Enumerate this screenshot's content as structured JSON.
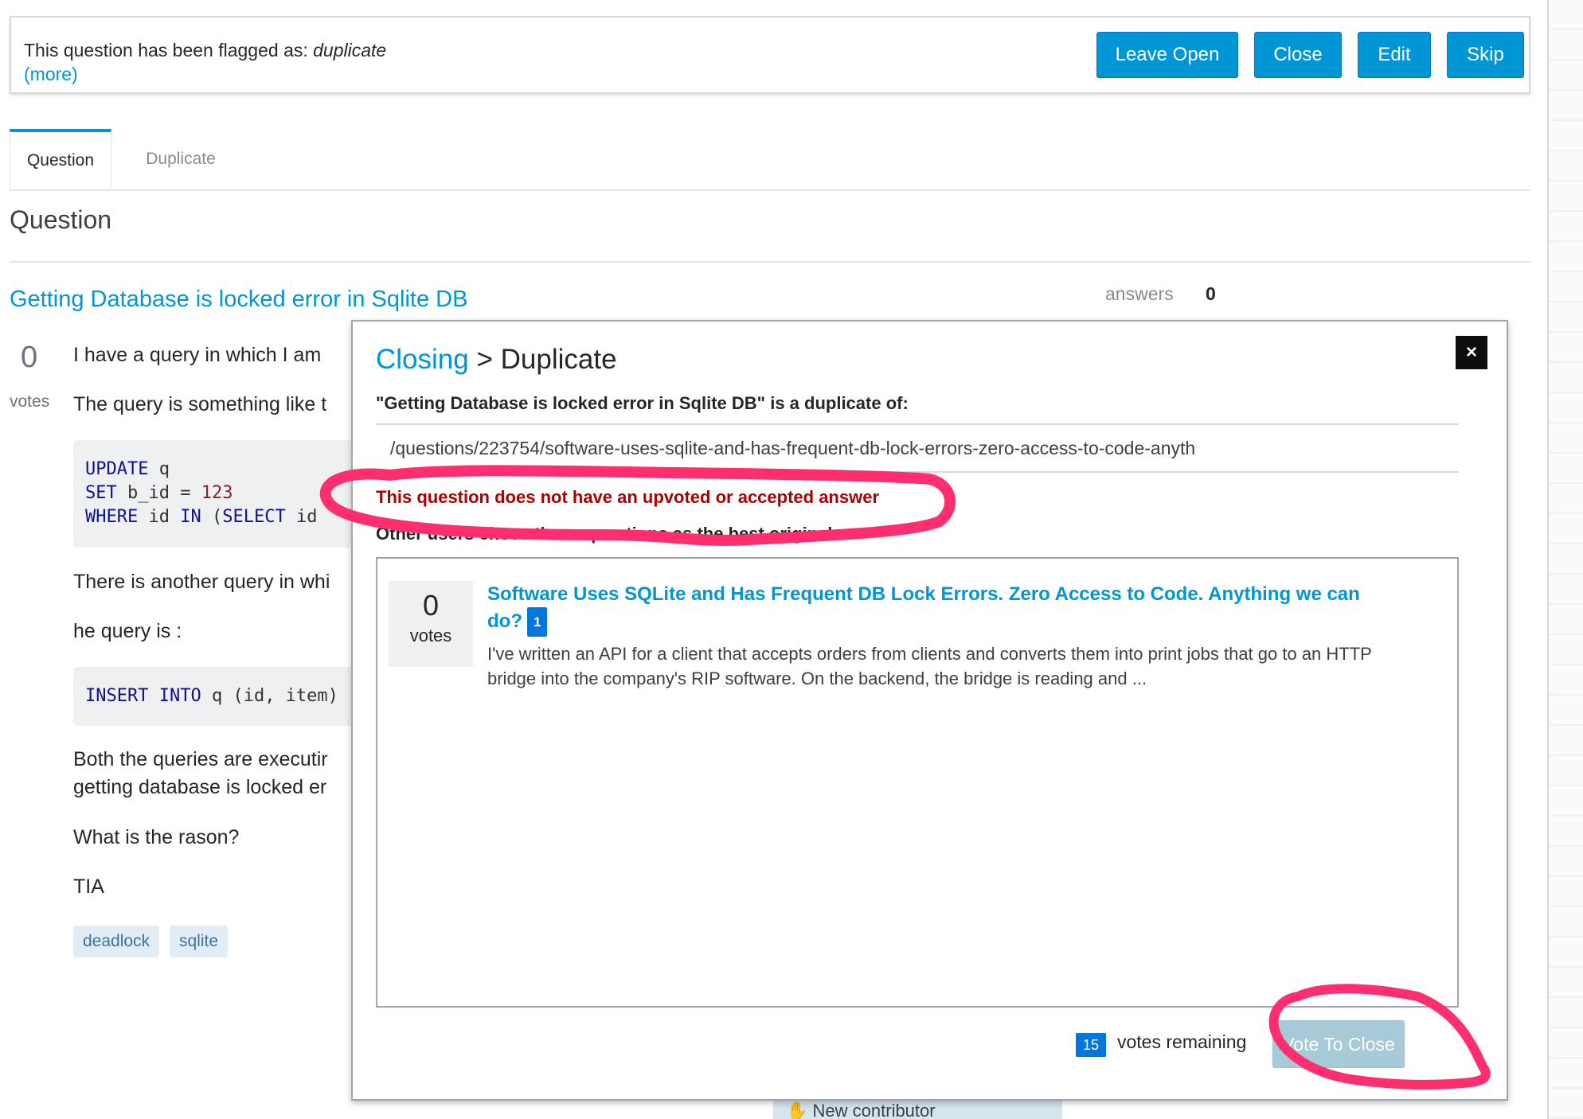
{
  "banner": {
    "flag_text": "This question has been flagged as:",
    "flag_reason": "duplicate",
    "more_link": "(more)",
    "buttons": [
      "Leave Open",
      "Close",
      "Edit",
      "Skip"
    ]
  },
  "tabs": [
    {
      "label": "Question",
      "active": true
    },
    {
      "label": "Duplicate",
      "active": false
    }
  ],
  "section_title": "Question",
  "question": {
    "title": "Getting Database is locked error in Sqlite DB",
    "answers_label": "answers",
    "answers_count": "0",
    "votes": "0",
    "votes_label": "votes",
    "paragraphs": [
      "I have a query in which I am",
      "The query is something like t",
      "There is another query in whi",
      "he query is :",
      "Both the queries are executir",
      "getting database is locked er",
      "What is the rason?",
      "TIA"
    ],
    "code1": {
      "line1_kw": "UPDATE",
      "line1_rest": " q",
      "line2_kw": "SET",
      "line2_rest": " b_id = ",
      "line2_num": "123",
      "line3_kw": "WHERE",
      "line3_mid": " id ",
      "line3_kw2": "IN",
      "line3_rest": " (",
      "line3_kw3": "SELECT",
      "line3_end": " id "
    },
    "code2": {
      "kw1": "INSERT",
      "kw2": "INTO",
      "rest": " q (id, item)"
    },
    "tags": [
      "deadlock",
      "sqlite"
    ],
    "new_contributor": "New contributor"
  },
  "modal": {
    "breadcrumb_link": "Closing",
    "breadcrumb_sep": " > ",
    "breadcrumb_current": "Duplicate",
    "close_icon": "×",
    "subtitle": "\"Getting Database is locked error in Sqlite DB\" is a duplicate of:",
    "input_value": "/questions/223754/software-uses-sqlite-and-has-frequent-db-lock-errors-zero-access-to-code-anyth",
    "warning": "This question does not have an upvoted or accepted answer",
    "other_users_text": "Other users chose these questions as the best original:",
    "results": [
      {
        "votes": "0",
        "votes_label": "votes",
        "title": "Software Uses SQLite and Has Frequent DB Lock Errors. Zero Access to Code. Anything we can do?",
        "answer_count": "1",
        "excerpt": "I've written an API for a client that accepts orders from clients and converts them into print jobs that go to an HTTP bridge into the company's RIP software. On the backend, the bridge is reading and ..."
      }
    ],
    "votes_remaining_count": "15",
    "votes_remaining_label": "votes remaining",
    "vote_button": "Vote To Close"
  },
  "colors": {
    "accent": "#0095d5",
    "warning": "#a90000",
    "annotation": "#ff2e6e",
    "disabled_button": "#a6cad6"
  }
}
